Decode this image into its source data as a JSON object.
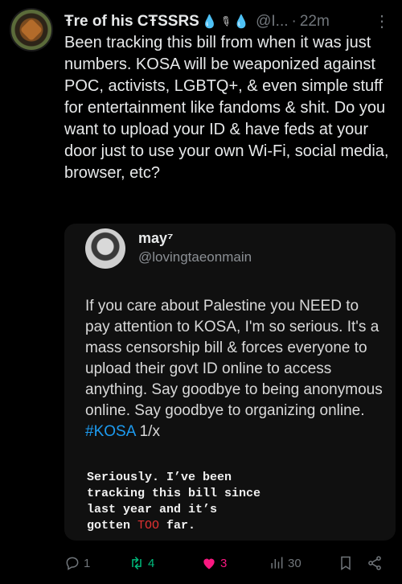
{
  "tweet": {
    "display_name": "Ŧre of his CŦSSRS",
    "handle": "@I...",
    "time": "22m",
    "text": "Been tracking this bill from when it was just numbers. KOSA will be weaponized against POC, activists, LGBTQ+, & even simple stuff for entertainment like fandoms & shit. Do you want to upload your ID & have feds at your door just to use your own Wi-Fi, social media, browser, etc?"
  },
  "media": {
    "name": "may⁷",
    "handle": "@lovingtaeonmain",
    "text": "If you care about Palestine you NEED to pay attention to KOSA, I'm so serious. It's a mass censorship bill & forces everyone to upload their govt ID online to access anything. Say goodbye to being anonymous online. Say goodbye to organizing online.",
    "hashtag": "#KOSA",
    "thread_count": "1/x",
    "caption_part1": "Seriously. I’ve been\ntracking this bill since\nlast year and it’s\ngotten ",
    "caption_red": "TOO",
    "caption_part2": " far."
  },
  "actions": {
    "replies": "1",
    "retweets": "4",
    "likes": "3",
    "views": "30"
  },
  "icons": [
    "reply-icon",
    "retweet-icon",
    "like-icon",
    "views-icon",
    "bookmark-icon",
    "share-icon",
    "more-icon"
  ],
  "colors": {
    "background": "#000000",
    "text": "#e7e9ea",
    "muted": "#71767b",
    "retweet": "#00ba7c",
    "like": "#f91880",
    "link": "#1d9bf0"
  }
}
